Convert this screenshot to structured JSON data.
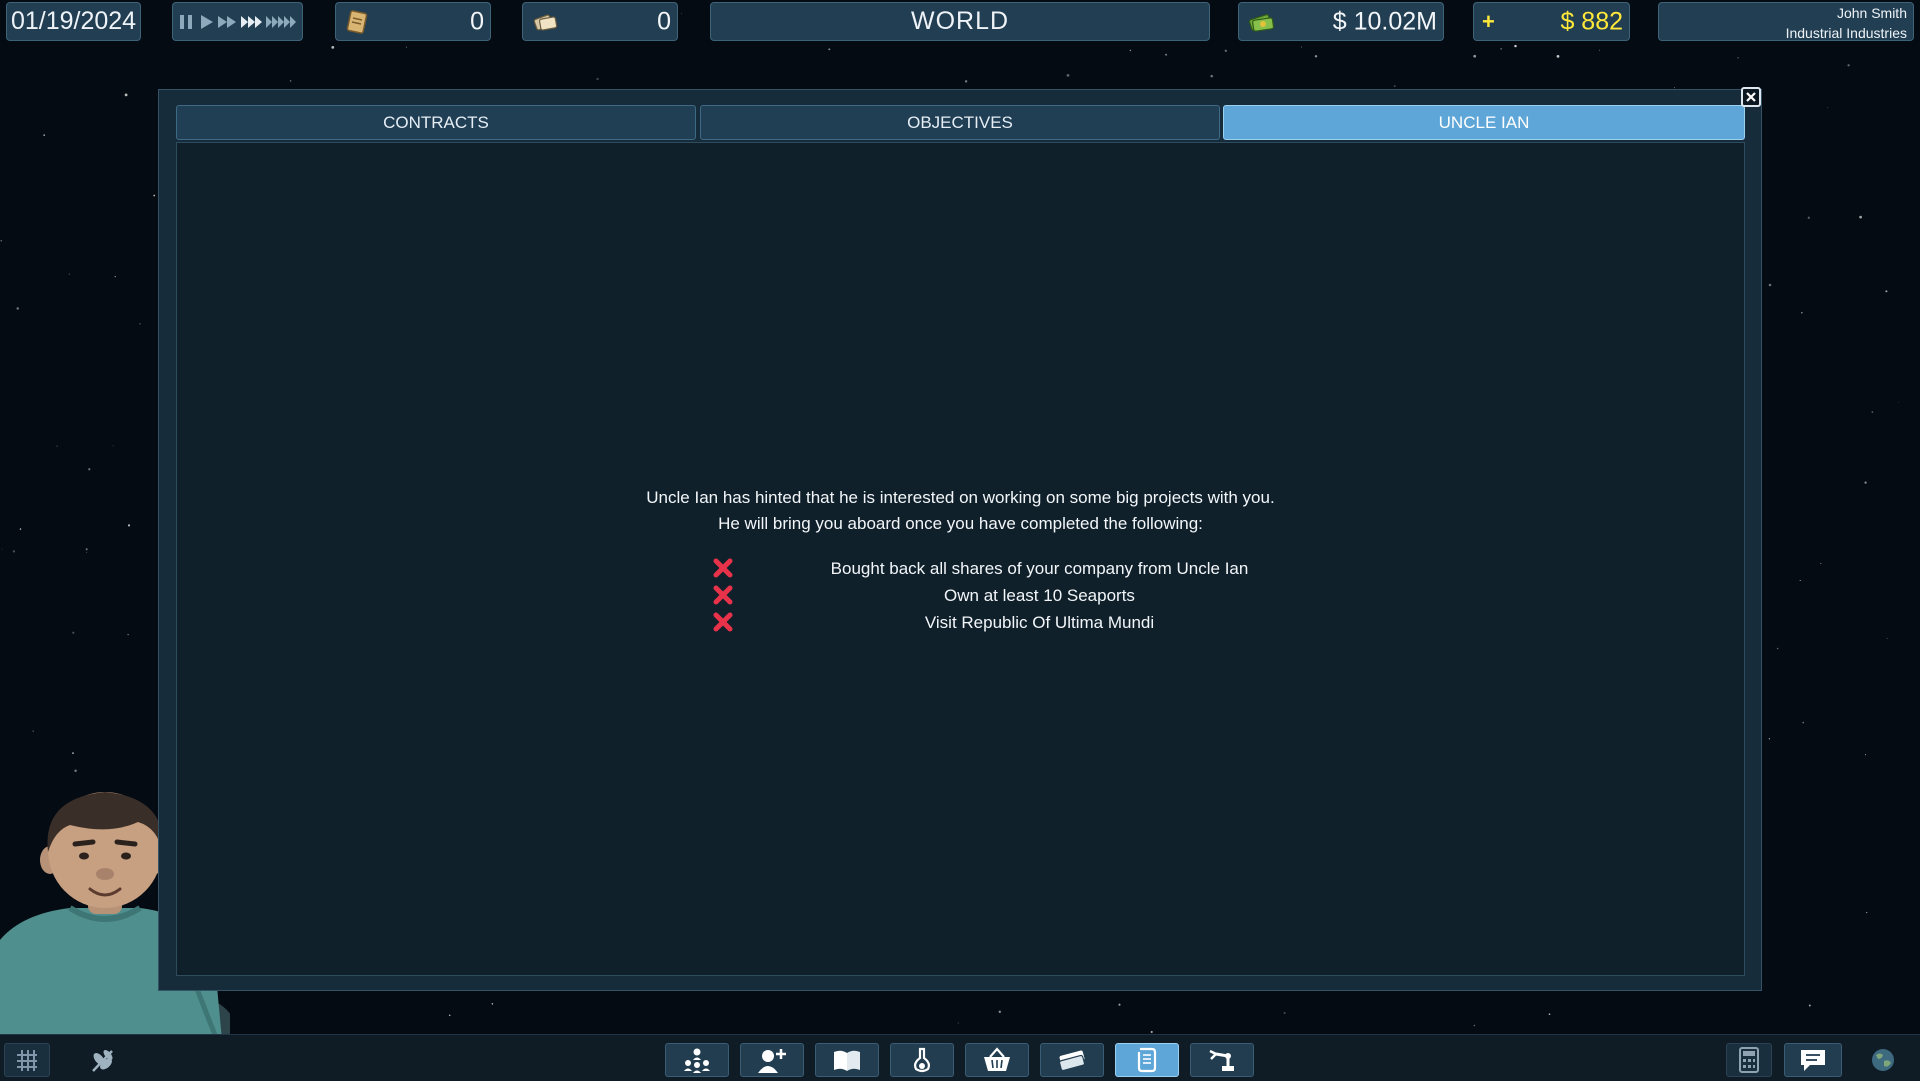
{
  "topbar": {
    "date": "01/19/2024",
    "contracts_count": "0",
    "shares_count": "0",
    "location": "WORLD",
    "money": "$ 10.02M",
    "income_sign": "+",
    "income": "$ 882",
    "player_name": "John Smith",
    "company_name": "Industrial Industries"
  },
  "tabs": [
    {
      "label": "CONTRACTS",
      "active": false
    },
    {
      "label": "OBJECTIVES",
      "active": false
    },
    {
      "label": "UNCLE IAN",
      "active": true
    }
  ],
  "uncle_ian": {
    "intro_line1": "Uncle Ian has hinted that he is interested on working on some big projects with you.",
    "intro_line2": "He will bring you aboard once you have completed the following:",
    "requirements": [
      {
        "text": "Bought back all shares of your company from Uncle Ian",
        "completed": false
      },
      {
        "text": "Own at least 10 Seaports",
        "completed": false
      },
      {
        "text": "Visit Republic Of Ultima Mundi",
        "completed": false
      }
    ]
  },
  "icons": {
    "contracts": "scroll-icon",
    "shares": "stock-papers-icon",
    "money": "cash-icon",
    "close": "close-icon",
    "requirement_failed": "red-x-icon"
  },
  "colors": {
    "accent": "#5fa6d8",
    "income": "#ffe83a",
    "fail": "#e8324a",
    "panel": "#10202b"
  },
  "bottom_toolbar": [
    {
      "icon": "grid-icon"
    },
    {
      "icon": "plant-icon"
    },
    {
      "icon": "org-chart-icon"
    },
    {
      "icon": "add-person-icon"
    },
    {
      "icon": "open-book-icon"
    },
    {
      "icon": "flask-icon"
    },
    {
      "icon": "basket-icon"
    },
    {
      "icon": "money-stack-icon"
    },
    {
      "icon": "scroll-icon",
      "active": true
    },
    {
      "icon": "robot-arm-icon"
    },
    {
      "icon": "calculator-icon"
    },
    {
      "icon": "chat-icon"
    },
    {
      "icon": "globe-icon"
    }
  ]
}
